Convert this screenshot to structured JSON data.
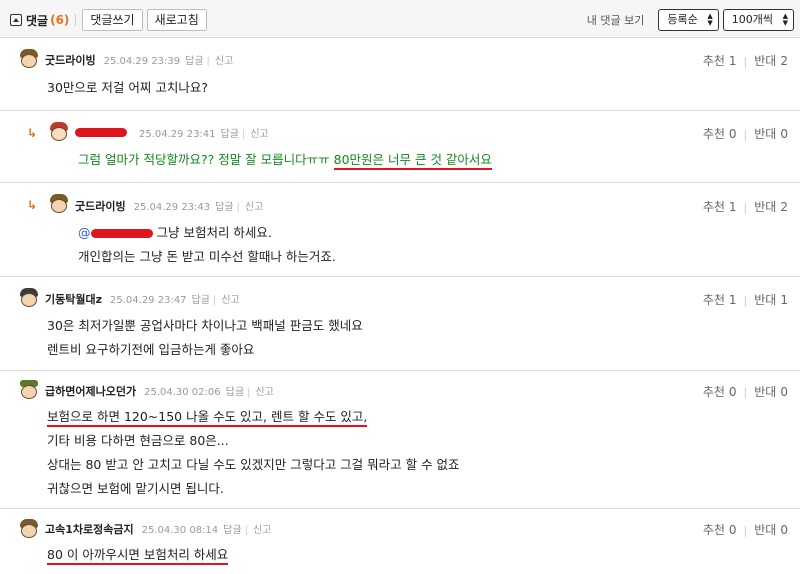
{
  "toolbar": {
    "title": "댓글",
    "count": "(6)",
    "write_label": "댓글쓰기",
    "refresh_label": "새로고침",
    "my_comments_label": "내 댓글 보기",
    "sort_select": "등록순",
    "page_size_select": "100개씩"
  },
  "vote_labels": {
    "up": "추천",
    "down": "반대",
    "reply": "답글",
    "report": "신고"
  },
  "comments": [
    {
      "author": "굿드라이빙",
      "date": "25.04.29 23:39",
      "up": "1",
      "down": "2",
      "lines": [
        "30만으로 저걸 어찌 고치나요?"
      ]
    },
    {
      "author": "",
      "date": "25.04.29 23:41",
      "up": "0",
      "down": "0",
      "line_a": "그럼 얼마가 적당할까요?? 정말 잘 모릅니다ㅠㅠ ",
      "line_b": "80만원은 너무 큰 것 같아서요"
    },
    {
      "author": "굿드라이빙",
      "date": "25.04.29 23:43",
      "up": "1",
      "down": "2",
      "mention": "@",
      "line_a": " 그냥 보험처리 하세요.",
      "line_b": "개인합의는 그냥 돈 받고 미수선 할때나 하는거죠."
    },
    {
      "author": "기동탁월대z",
      "date": "25.04.29 23:47",
      "up": "1",
      "down": "1",
      "lines": [
        "30은 최저가일뿐 공업사마다 차이나고 백패널 판금도 했네요",
        "렌트비 요구하기전에 입금하는게 좋아요"
      ]
    },
    {
      "author": "급하면어제나오던가",
      "date": "25.04.30 02:06",
      "up": "0",
      "down": "0",
      "line_a": "보험으로 하면 120~150 나올 수도 있고, 렌트 할 수도 있고,",
      "lines": [
        "기타 비용 다하면 현금으로 80은...",
        "상대는 80 받고 안 고치고 다닐 수도 있겠지만 그렇다고 그걸 뭐라고 할 수 없죠",
        "귀찮으면 보험에 맡기시면 됩니다."
      ]
    },
    {
      "author": "고속1차로정속금지",
      "date": "25.04.30 08:14",
      "up": "0",
      "down": "0",
      "line_a": "80 이 아까우시면 보험처리 하세요"
    }
  ],
  "colors": {
    "accent_orange": "#e8711c",
    "reply_green": "#138a1c",
    "highlight_red": "#e0141e"
  }
}
